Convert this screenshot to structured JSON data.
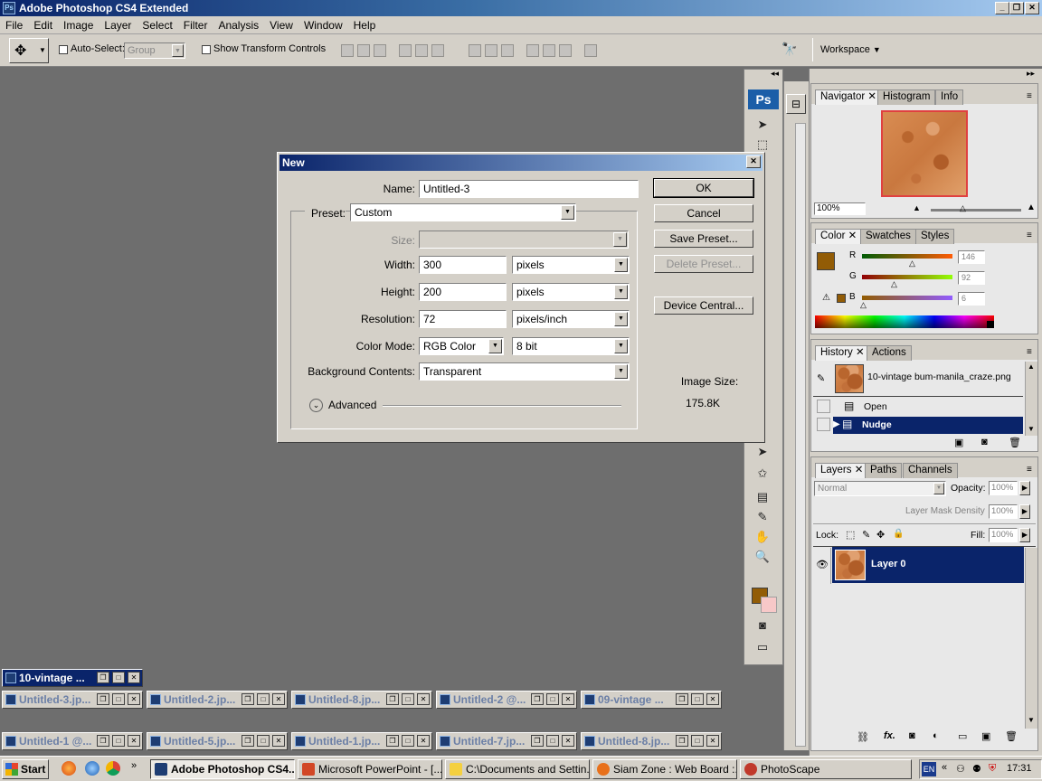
{
  "app": {
    "title": "Adobe Photoshop CS4 Extended",
    "logo": "Ps"
  },
  "menu": [
    "File",
    "Edit",
    "Image",
    "Layer",
    "Select",
    "Filter",
    "Analysis",
    "View",
    "Window",
    "Help"
  ],
  "options": {
    "auto_select_label": "Auto-Select:",
    "auto_select_value": "Group",
    "show_transform_label": "Show Transform Controls",
    "workspace_label": "Workspace"
  },
  "dialog": {
    "title": "New",
    "name_label": "Name:",
    "name_value": "Untitled-3",
    "preset_label": "Preset:",
    "preset_value": "Custom",
    "size_label": "Size:",
    "size_value": "",
    "width_label": "Width:",
    "width_value": "300",
    "width_unit": "pixels",
    "height_label": "Height:",
    "height_value": "200",
    "height_unit": "pixels",
    "resolution_label": "Resolution:",
    "resolution_value": "72",
    "resolution_unit": "pixels/inch",
    "color_mode_label": "Color Mode:",
    "color_mode_value": "RGB Color",
    "bit_depth": "8 bit",
    "background_label": "Background Contents:",
    "background_value": "Transparent",
    "advanced_label": "Advanced",
    "ok": "OK",
    "cancel": "Cancel",
    "save_preset": "Save Preset...",
    "delete_preset": "Delete Preset...",
    "device_central": "Device Central...",
    "image_size_label": "Image Size:",
    "image_size_value": "175.8K"
  },
  "navigator": {
    "tabs": [
      "Navigator",
      "Histogram",
      "Info"
    ],
    "zoom": "100%"
  },
  "color_panel": {
    "tabs": [
      "Color",
      "Swatches",
      "Styles"
    ],
    "r_label": "R",
    "r_value": "146",
    "g_label": "G",
    "g_value": "92",
    "b_label": "B",
    "b_value": "6",
    "foreground": "#925c06",
    "background": "#f7c8c8"
  },
  "history": {
    "tabs": [
      "History",
      "Actions"
    ],
    "snapshot": "10-vintage bum-manila_craze.png",
    "steps": [
      "Open",
      "Nudge"
    ]
  },
  "layers": {
    "tabs": [
      "Layers",
      "Paths",
      "Channels"
    ],
    "blend_mode": "Normal",
    "opacity_label": "Opacity:",
    "opacity_value": "100%",
    "mask_density_label": "Layer Mask Density",
    "mask_density_value": "100%",
    "lock_label": "Lock:",
    "fill_label": "Fill:",
    "fill_value": "100%",
    "layer_name": "Layer 0"
  },
  "docs": {
    "row1": [
      "10-vintage ..."
    ],
    "row2": [
      "Untitled-3.jp...",
      "Untitled-2.jp...",
      "Untitled-8.jp...",
      "Untitled-2 @...",
      "09-vintage ..."
    ],
    "row3": [
      "Untitled-1 @...",
      "Untitled-5.jp...",
      "Untitled-1.jp...",
      "Untitled-7.jp...",
      "Untitled-8.jp..."
    ]
  },
  "taskbar": {
    "start": "Start",
    "items": [
      "Adobe Photoshop CS4...",
      "Microsoft PowerPoint - [...",
      "C:\\Documents and Settin...",
      "Siam Zone : Web Board :...",
      "PhotoScape"
    ],
    "lang": "EN",
    "clock": "17:31"
  }
}
